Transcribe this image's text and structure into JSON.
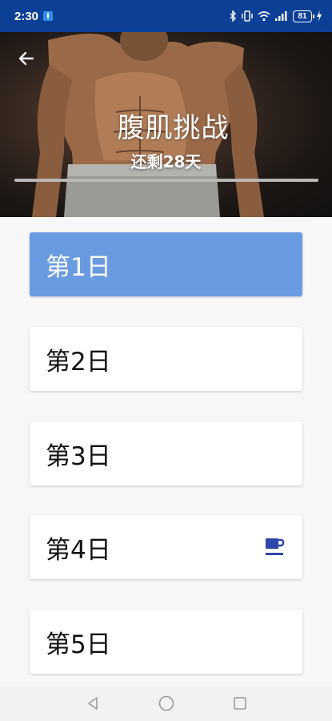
{
  "status_bar": {
    "time": "2:30",
    "battery": "81"
  },
  "header": {
    "title": "腹肌挑战",
    "subtitle": "还剩28天",
    "progress": 0.0
  },
  "days": [
    {
      "label": "第1日",
      "active": true,
      "rest": false
    },
    {
      "label": "第2日",
      "active": false,
      "rest": false
    },
    {
      "label": "第3日",
      "active": false,
      "rest": false
    },
    {
      "label": "第4日",
      "active": false,
      "rest": true
    },
    {
      "label": "第5日",
      "active": false,
      "rest": false
    }
  ],
  "colors": {
    "status_bar": "#0d3f96",
    "active_card": "#6a9be0",
    "rest_icon": "#2f47a8"
  },
  "icons": {
    "back": "arrow-left-icon",
    "rest": "coffee-cup-icon",
    "nav": [
      "back-triangle-icon",
      "home-circle-icon",
      "recents-square-icon"
    ]
  }
}
